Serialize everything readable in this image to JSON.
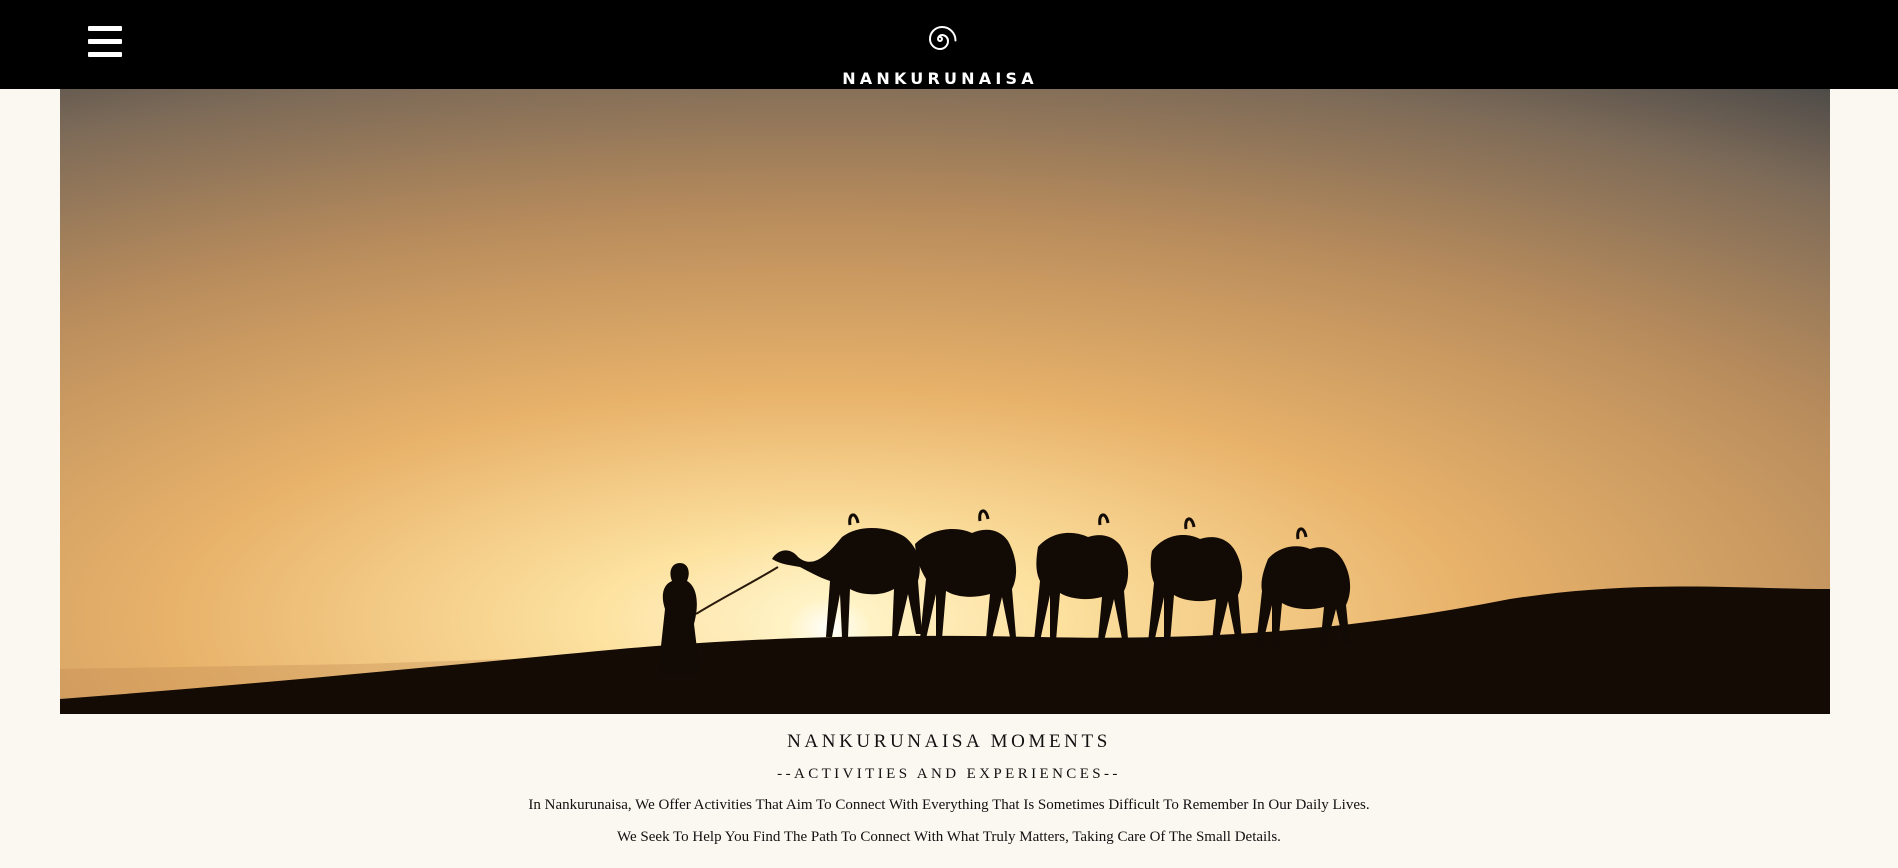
{
  "header": {
    "menu_icon": "hamburger-menu-icon",
    "logo_icon": "spiral-logo-icon",
    "brand": "NANKURUNAISA",
    "background": "#000000"
  },
  "hero": {
    "image_subject": "camel caravan silhouette at sunset in the desert"
  },
  "section": {
    "title": "NANKURUNAISA MOMENTS",
    "subtitle": "--ACTIVITIES AND EXPERIENCES--",
    "paragraphs": [
      "In Nankurunaisa, We Offer Activities That Aim To Connect With Everything That Is Sometimes Difficult To Remember In Our Daily Lives.",
      "We Seek To Help You Find The Path To Connect With What Truly Matters, Taking Care Of The Small Details."
    ]
  },
  "colors": {
    "page_background": "#fbf7f1",
    "text": "#111111",
    "header_text": "#ffffff"
  }
}
